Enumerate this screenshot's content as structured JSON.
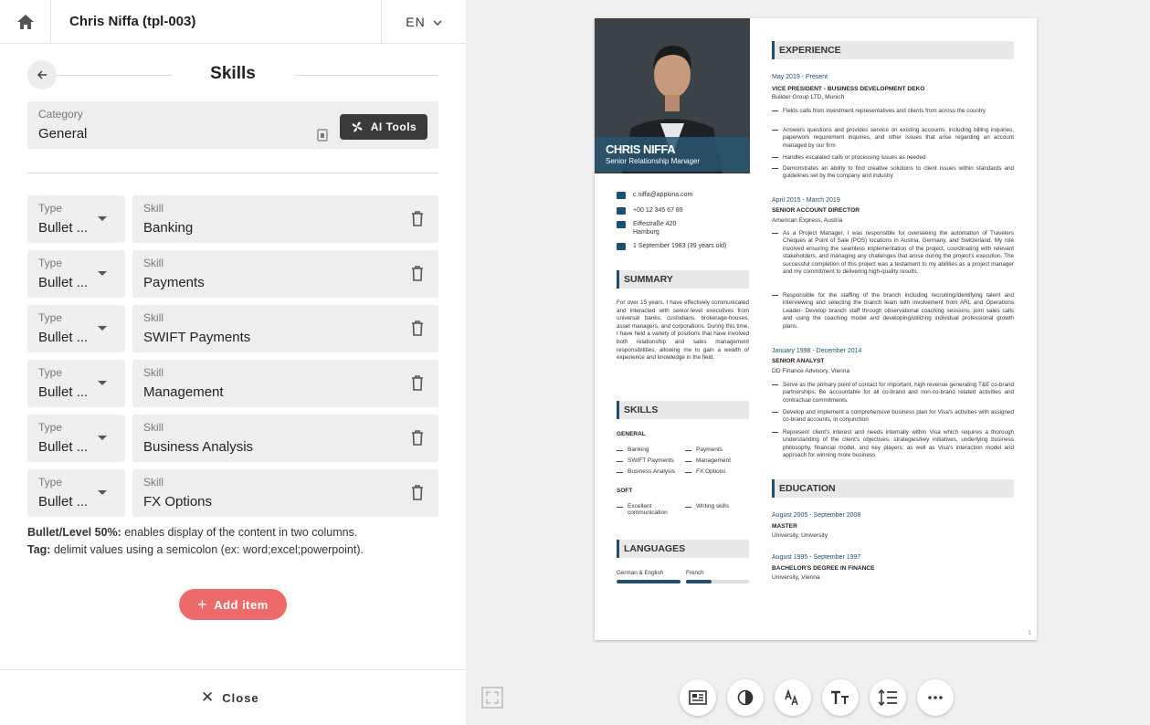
{
  "header": {
    "doc_title": "Chris Niffa (tpl-003)",
    "lang": "EN"
  },
  "section": {
    "title": "Skills"
  },
  "category": {
    "label": "Category",
    "value": "General",
    "ai_tools_label": "AI Tools"
  },
  "items": [
    {
      "type_label": "Type",
      "type_value": "Bullet ...",
      "skill_label": "Skill",
      "skill_value": "Banking"
    },
    {
      "type_label": "Type",
      "type_value": "Bullet ...",
      "skill_label": "Skill",
      "skill_value": "Payments"
    },
    {
      "type_label": "Type",
      "type_value": "Bullet ...",
      "skill_label": "Skill",
      "skill_value": "SWIFT Payments"
    },
    {
      "type_label": "Type",
      "type_value": "Bullet ...",
      "skill_label": "Skill",
      "skill_value": "Management"
    },
    {
      "type_label": "Type",
      "type_value": "Bullet ...",
      "skill_label": "Skill",
      "skill_value": "Business Analysis"
    },
    {
      "type_label": "Type",
      "type_value": "Bullet ...",
      "skill_label": "Skill",
      "skill_value": "FX Options"
    }
  ],
  "notes": {
    "line1_bold": "Bullet/Level 50%:",
    "line1_text": " enables display of the content in two columns.",
    "line2_bold": "Tag:",
    "line2_text": " delimit values using a semicolon (ex: word;excel;powerpoint)."
  },
  "add_item_label": "Add item",
  "close_label": "Close",
  "colors": {
    "accent": "#ef6a6a",
    "cv_primary": "#1e4f6e",
    "dark_button": "#3a3a3a"
  },
  "cv": {
    "name": "CHRIS NIFFA",
    "role": "Senior Relationship Manager",
    "contacts": [
      "c.niffa@appkina.com",
      "+00 12 345 67 89",
      "Eiffestraße 420",
      "Hamburg",
      "1 September 1983 (39 years old)"
    ],
    "summary_title": "SUMMARY",
    "summary": "For over 15 years, I have effectively communicated and interacted with senior-level executives from universal banks, custodians, brokerage-houses, asset managers, and corporations. During this time, I have held a variety of positions that have involved both relationship and sales management responsibilities, allowing me to gain a wealth of experience and knowledge in the field.",
    "skills_title": "SKILLS",
    "skills_general_label": "GENERAL",
    "skills_general": [
      "Banking",
      "Payments",
      "SWIFT Payments",
      "Management",
      "Business Analysis",
      "FX Options"
    ],
    "skills_soft_label": "SOFT",
    "skills_soft": [
      "Excellent communication",
      "Writing skills"
    ],
    "languages_title": "LANGUAGES",
    "languages": [
      {
        "name": "German & English",
        "level": 1.0
      },
      {
        "name": "French",
        "level": 0.4
      }
    ],
    "experience_title": "EXPERIENCE",
    "jobs": [
      {
        "date": "May 2019 - Present",
        "title": "VICE PRESIDENT - BUSINESS DEVELOPMENT DEKO",
        "org": "Builder Group LTD, Munich",
        "bullets": [
          "Fields calls from investment representatives and clients from across the country",
          "Answers questions and provides service on existing accounts, including billing inquiries, paperwork requirement inquiries, and other issues that arise regarding an account managed by our firm",
          "Handles escalated calls or processing issues as needed",
          "Demonstrates an ability to find creative solutions to client issues within standards and guidelines set by the company and industry"
        ]
      },
      {
        "date": "April 2015 - March 2019",
        "title": "SENIOR ACCOUNT DIRECTOR",
        "org": "American Express, Austria",
        "bullets": [
          "As a Project Manager, I was responsible for overseeing the automation of Travelers Cheques at Point of Sale (POS) locations in Austria, Germany, and Switzerland. My role involved ensuring the seamless implementation of the project, coordinating with relevant stakeholders, and managing any challenges that arose during the project's execution. The successful completion of this project was a testament to my abilities as a project manager and my commitment to delivering high-quality results.",
          "Responsible for the staffing of the branch including recruiting/identifying talent and interviewing and selecting the branch team with involvement from ARL and Operations Leader- Develop branch staff through observational coaching sessions, joint sales calls and using the coaching model and developing/utilizing individual professional growth plans."
        ]
      },
      {
        "date": "January 1998 - December 2014",
        "title": "SENIOR ANALYST",
        "org": "DD Finance Advisory, Vienna",
        "bullets": [
          "Serve as the primary point of contact for important, high revenue generating T&E co-brand partnerships; Be accountable for all co-brand and non-co-brand related activities and contractual commitments.",
          "Develop and implement a comprehensive business plan for Visa's activities with assigned co-brand accounts, in conjunction",
          "Represent client's interest and needs internally within Visa which requires a thorough understanding of the client's objectives, strategies/key initiatives, underlying business philosophy, financial model, and key players; as well as Visa's interaction model and approach for winning more business"
        ]
      }
    ],
    "education_title": "EDUCATION",
    "education": [
      {
        "date": "August 2005 - September 2008",
        "title": "MASTER",
        "org": "University, University"
      },
      {
        "date": "August 1995 - September 1997",
        "title": "BACHELOR'S DEGREE IN FINANCE",
        "org": "University, Vienna"
      }
    ],
    "page_number": "1"
  },
  "toolbar_icons": [
    "fit-screen-icon",
    "layout-icon",
    "contrast-icon",
    "font-icon",
    "text-size-icon",
    "line-spacing-icon",
    "more-icon"
  ]
}
